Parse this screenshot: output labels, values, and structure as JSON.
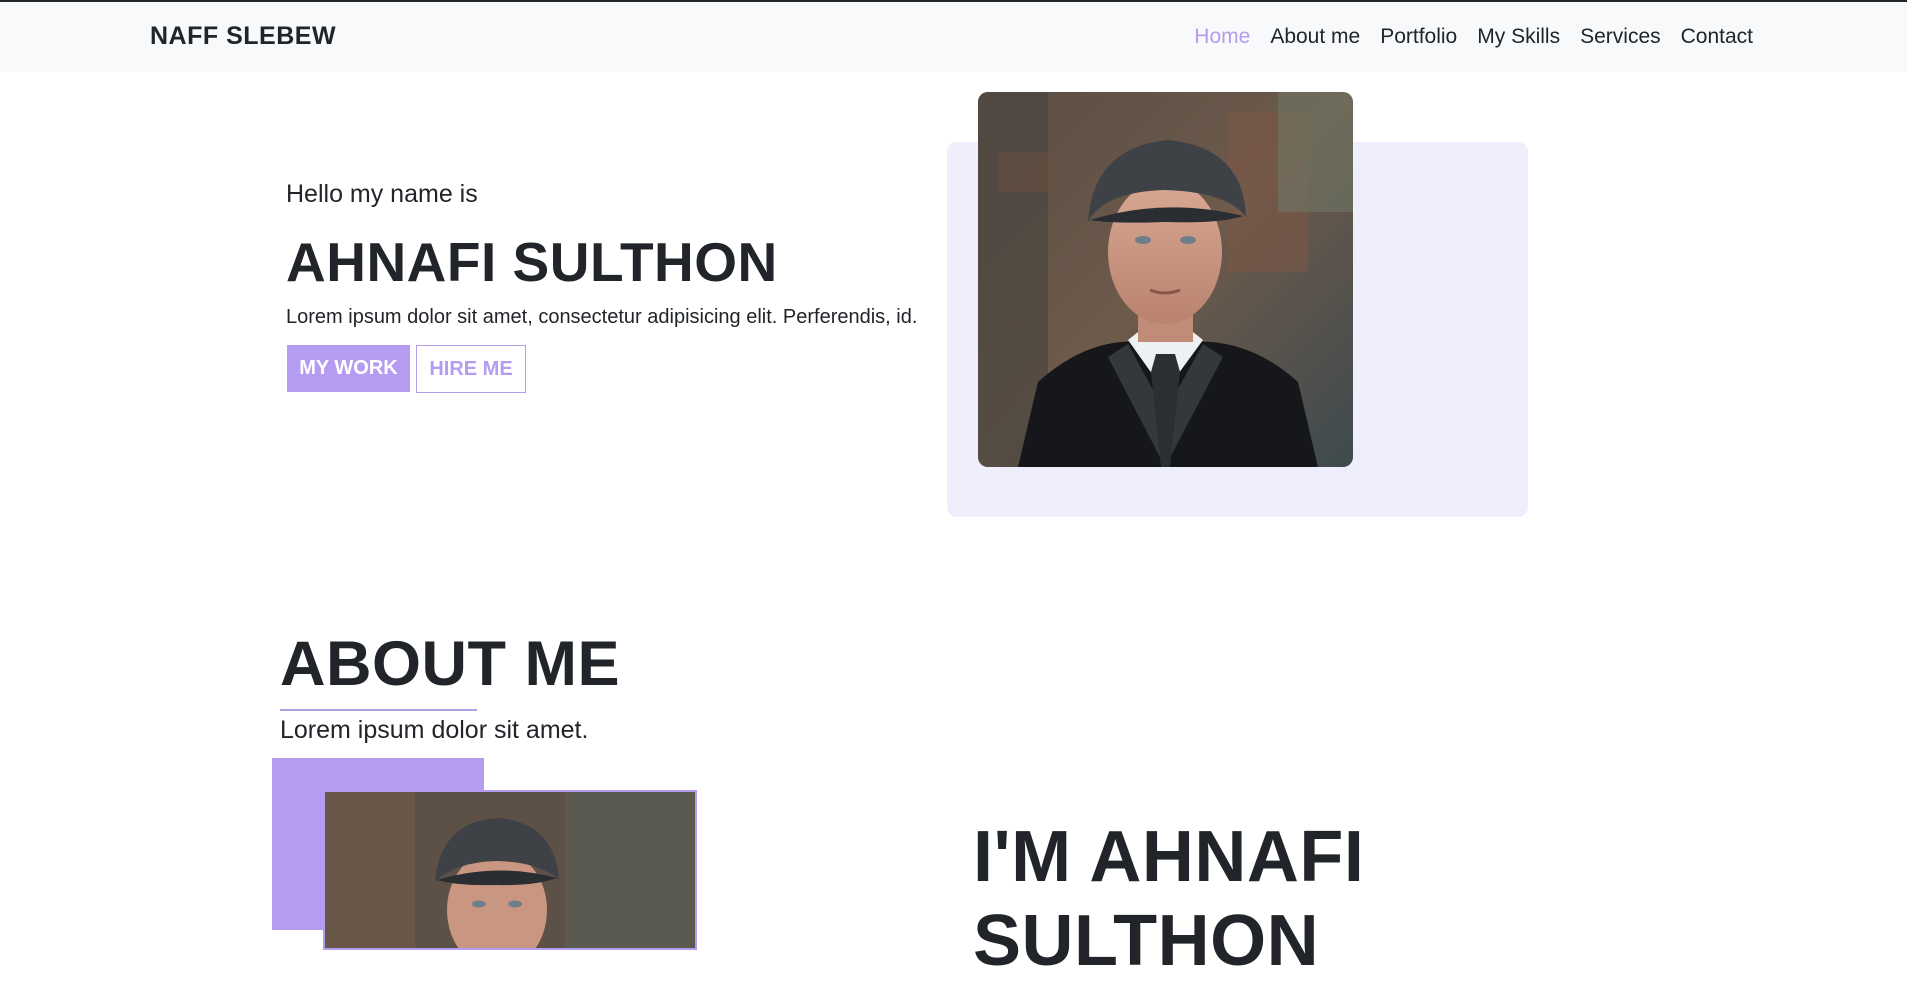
{
  "navbar": {
    "brand": "NAFF SLEBEW",
    "links": [
      "Home",
      "About me",
      "Portfolio",
      "My Skills",
      "Services",
      "Contact"
    ],
    "active_index": 0
  },
  "hero": {
    "greeting": "Hello my name is",
    "name": "AHNAFI SULTHON",
    "description": "Lorem ipsum dolor sit amet, consectetur adipisicing elit. Perferendis, id.",
    "primary_button": "MY WORK",
    "secondary_button": "HIRE ME"
  },
  "about": {
    "title": "ABOUT ME",
    "subtitle": "Lorem ipsum dolor sit amet.",
    "heading": "I'M AHNAFI SULTHON"
  },
  "colors": {
    "accent": "#b59cf0",
    "hero_card": "#eeeefc",
    "text": "#212529",
    "navbar": "#f8f9fa"
  }
}
